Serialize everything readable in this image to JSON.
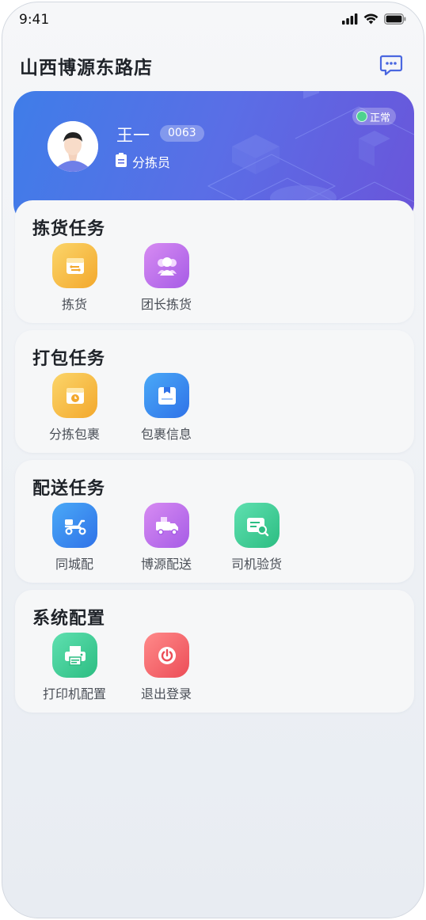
{
  "status_bar": {
    "time": "9:41"
  },
  "header": {
    "title": "山西博源东路店",
    "message_icon": "chat-bubble-icon"
  },
  "profile": {
    "name": "王一",
    "id": "0063",
    "role": "分拣员",
    "status": "正常",
    "status_color": "#4ed18f"
  },
  "sections": [
    {
      "title": "拣货任务",
      "items": [
        {
          "label": "拣货",
          "icon": "box-icon",
          "color": "#f3a82c"
        },
        {
          "label": "团长拣货",
          "icon": "users-icon",
          "color": "#a65ce6"
        }
      ]
    },
    {
      "title": "打包任务",
      "items": [
        {
          "label": "分拣包裹",
          "icon": "package-clock-icon",
          "color": "#f3a82c"
        },
        {
          "label": "包裹信息",
          "icon": "package-info-icon",
          "color": "#2f72e8"
        }
      ]
    },
    {
      "title": "配送任务",
      "items": [
        {
          "label": "同城配",
          "icon": "scooter-icon",
          "color": "#2f72e8"
        },
        {
          "label": "博源配送",
          "icon": "truck-icon",
          "color": "#a65ce6"
        },
        {
          "label": "司机验货",
          "icon": "inspect-icon",
          "color": "#2cbd82"
        }
      ]
    },
    {
      "title": "系统配置",
      "items": [
        {
          "label": "打印机配置",
          "icon": "printer-icon",
          "color": "#2cbd82"
        },
        {
          "label": "退出登录",
          "icon": "power-icon",
          "color": "#ec4d57"
        }
      ]
    }
  ]
}
